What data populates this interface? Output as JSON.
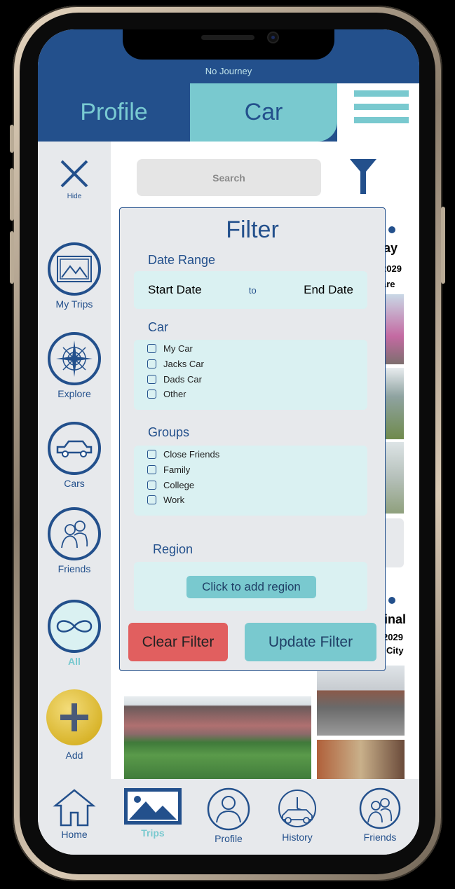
{
  "status": {
    "journey": "No Journey"
  },
  "header": {
    "tab_profile": "Profile",
    "tab_car": "Car"
  },
  "sidebar": {
    "hide": "Hide",
    "items": [
      {
        "label": "My Trips",
        "icon": "photo-icon"
      },
      {
        "label": "Explore",
        "icon": "compass-icon"
      },
      {
        "label": "Cars",
        "icon": "car-icon"
      },
      {
        "label": "Friends",
        "icon": "friends-icon"
      },
      {
        "label": "All",
        "icon": "infinity-icon"
      },
      {
        "label": "Add",
        "icon": "plus-icon"
      }
    ]
  },
  "search": {
    "placeholder": "Search"
  },
  "background_cards": {
    "card1_title_fragment": "ay",
    "card1_year": "2029",
    "card1_loc": "are",
    "card2_title_fragment": "inal",
    "card2_year": "2029",
    "card2_loc": "City"
  },
  "filter": {
    "title": "Filter",
    "date_range_label": "Date Range",
    "start_date": "Start Date",
    "to": "to",
    "end_date": "End Date",
    "car_label": "Car",
    "cars": [
      "My Car",
      "Jacks Car",
      "Dads Car",
      "Other"
    ],
    "groups_label": "Groups",
    "groups": [
      "Close Friends",
      "Family",
      "College",
      "Work"
    ],
    "region_label": "Region",
    "region_button": "Click to add region",
    "clear_button": "Clear Filter",
    "update_button": "Update Filter"
  },
  "bottom_nav": {
    "home": "Home",
    "trips": "Trips",
    "profile": "Profile",
    "history": "History",
    "friends": "Friends"
  },
  "colors": {
    "primary": "#23508c",
    "accent": "#79c9cf",
    "danger": "#e15f5f",
    "panel": "#daf1f2"
  }
}
